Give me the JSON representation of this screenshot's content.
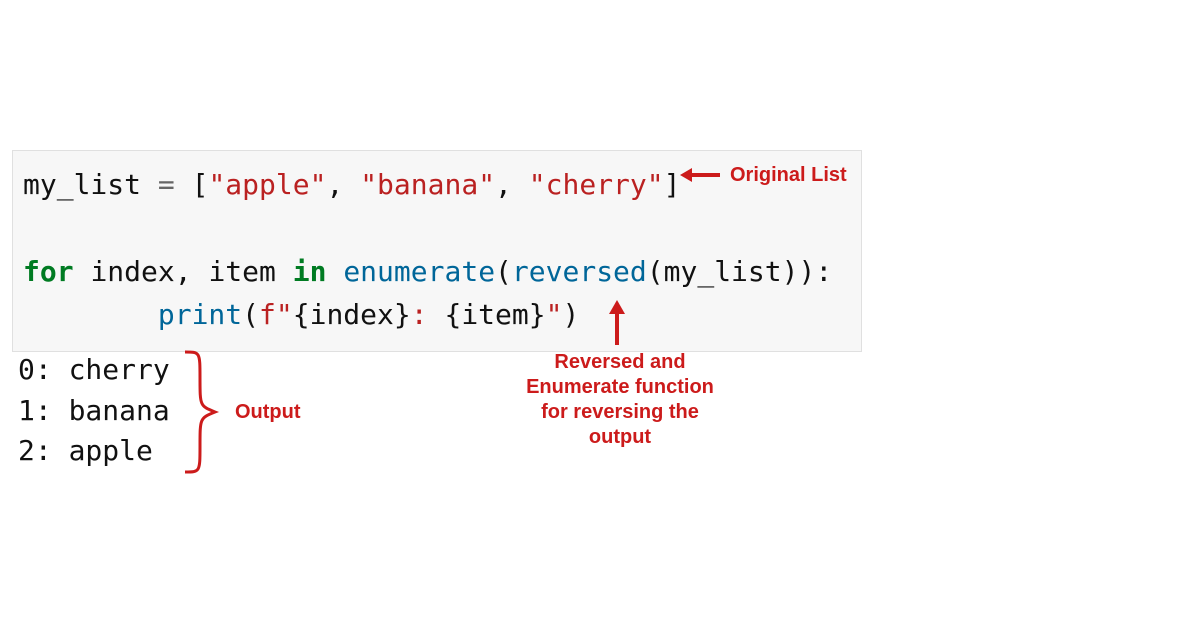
{
  "code": {
    "line1": {
      "var": "my_list",
      "eq": " = ",
      "lb": "[",
      "s1": "\"apple\"",
      "c1": ", ",
      "s2": "\"banana\"",
      "c2": ", ",
      "s3": "\"cherry\"",
      "rb": "]"
    },
    "blank": "",
    "line3": {
      "kw_for": "for",
      "sp1": " ",
      "idx": "index",
      "comma": ", ",
      "item": "item",
      "sp2": " ",
      "kw_in": "in",
      "sp3": " ",
      "fn_enum": "enumerate",
      "lp1": "(",
      "fn_rev": "reversed",
      "lp2": "(",
      "arg": "my_list",
      "rp2": ")",
      "rp1": ")",
      "colon": ":"
    },
    "line4": {
      "indent": "        ",
      "fn_print": "print",
      "lp": "(",
      "fpref": "f",
      "q1": "\"",
      "lb1": "{",
      "inner1": "index",
      "rb1": "}",
      "mid": ": ",
      "lb2": "{",
      "inner2": "item",
      "rb2": "}",
      "q2": "\"",
      "rp": ")"
    }
  },
  "output": {
    "l1": "0: cherry",
    "l2": "1: banana",
    "l3": "2: apple"
  },
  "annotations": {
    "original_list": "Original List",
    "reversed_note": "Reversed and\nEnumerate function\nfor reversing the\noutput",
    "output_label": "Output"
  }
}
